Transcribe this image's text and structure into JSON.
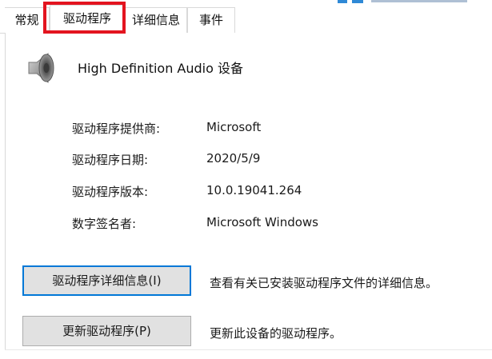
{
  "tabs": [
    {
      "label": "常规",
      "selected": false
    },
    {
      "label": "驱动程序",
      "selected": true
    },
    {
      "label": "详细信息",
      "selected": false
    },
    {
      "label": "事件",
      "selected": false
    }
  ],
  "highlight_color": "#e3141f",
  "device": {
    "icon": "speaker-icon",
    "name": "High Definition Audio 设备"
  },
  "driver_info": [
    {
      "label": "驱动程序提供商:",
      "value": "Microsoft"
    },
    {
      "label": "驱动程序日期:",
      "value": "2020/5/9"
    },
    {
      "label": "驱动程序版本:",
      "value": "10.0.19041.264"
    },
    {
      "label": "数字签名者:",
      "value": "Microsoft Windows"
    }
  ],
  "actions": [
    {
      "button": "驱动程序详细信息(I)",
      "description": "查看有关已安装驱动程序文件的详细信息。",
      "focused": true
    },
    {
      "button": "更新驱动程序(P)",
      "description": "更新此设备的驱动程序。",
      "focused": false
    }
  ],
  "colors": {
    "focus_border": "#0078d7",
    "button_bg": "#e1e1e1",
    "tab_border": "#d9d9d9"
  }
}
